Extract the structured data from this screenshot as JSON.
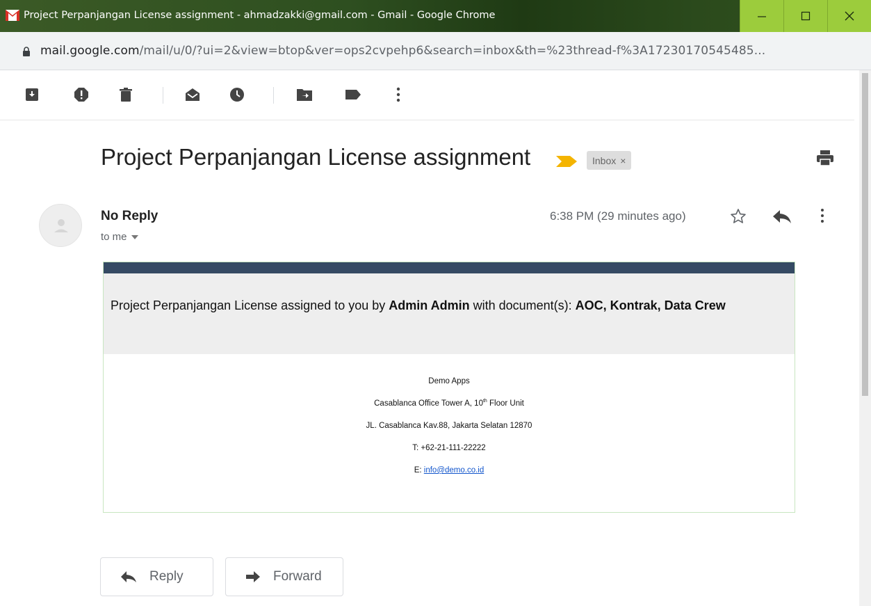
{
  "window": {
    "title": "Project Perpanjangan License assignment - ahmadzakki@gmail.com - Gmail - Google Chrome",
    "minimize_label": "–",
    "maximize_label": "☐",
    "close_label": "✕",
    "accent_color": "#9ccc3c"
  },
  "addressbar": {
    "host": "mail.google.com",
    "path": "/mail/u/0/?ui=2&view=btop&ver=ops2cvpehp6&search=inbox&th=%23thread-f%3A17230170545485..."
  },
  "toolbar": {
    "icons": [
      "archive-icon",
      "report-spam-icon",
      "delete-icon",
      "mark-unread-icon",
      "snooze-icon",
      "move-to-icon",
      "label-icon",
      "more-vert-icon"
    ]
  },
  "message": {
    "subject": "Project Perpanjangan License assignment",
    "label_chip": "Inbox",
    "label_chip_close": "×",
    "sender": "No Reply",
    "recipient": "to me",
    "timestamp": "6:38 PM (29 minutes ago)"
  },
  "email_body": {
    "lead": "Project Perpanjangan License assigned to you by ",
    "assigner": "Admin Admin",
    "mid": " with document(s): ",
    "documents": "AOC, Kontrak, Data Crew",
    "company": "Demo Apps",
    "address_line1_pre": "Casablanca Office Tower A, 10",
    "address_line1_sup": "th",
    "address_line1_post": " Floor Unit",
    "address_line2": "JL. Casablanca Kav.88, Jakarta Selatan 12870",
    "phone": "T: +62-21-111-22222",
    "email_prefix": "E: ",
    "email_link": "info@demo.co.id"
  },
  "actions": {
    "reply": "Reply",
    "forward": "Forward"
  }
}
